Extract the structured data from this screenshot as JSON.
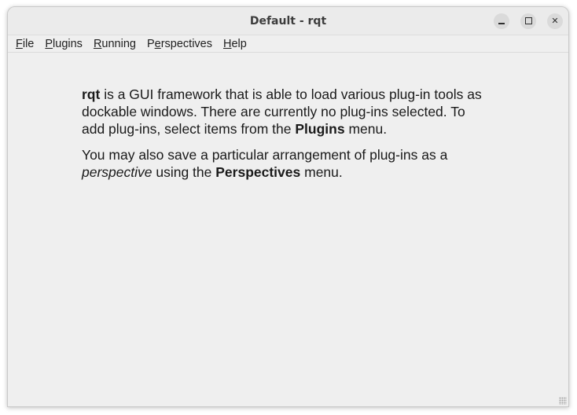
{
  "window": {
    "title": "Default - rqt",
    "controls": {
      "minimize_icon": "minimize-icon",
      "maximize_icon": "maximize-icon",
      "close_icon": "close-icon",
      "close_glyph": "✕"
    }
  },
  "menubar": {
    "items": [
      {
        "first": "F",
        "rest": "ile"
      },
      {
        "first": "P",
        "rest": "lugins"
      },
      {
        "first": "R",
        "rest": "unning"
      },
      {
        "pre": "P",
        "first": "e",
        "rest": "rspectives"
      },
      {
        "first": "H",
        "rest": "elp"
      }
    ]
  },
  "content": {
    "p1": {
      "bold_start": "rqt",
      "text_a": " is a GUI framework that is able to load various plug-in tools as dockable windows. There are currently no plug-ins selected. To add plug-ins, select items from the ",
      "bold_plugins": "Plugins",
      "text_b": " menu."
    },
    "p2": {
      "text_a": "You may also save a particular arrangement of plug-ins as a ",
      "italic_perspective": "perspective",
      "text_b": " using the ",
      "bold_perspectives": "Perspectives",
      "text_c": " menu."
    }
  },
  "colors": {
    "window_bg": "#efefef",
    "titlebar_bg": "#ebebeb",
    "text": "#1a1a1a"
  }
}
